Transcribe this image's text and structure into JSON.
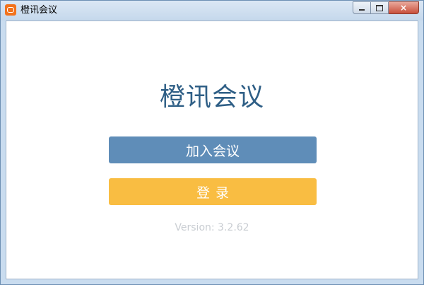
{
  "window": {
    "title": "橙讯会议",
    "controls": {
      "close_label": "×"
    }
  },
  "main": {
    "brand_title": "橙讯会议",
    "join_button_label": "加入会议",
    "login_button_label": "登录",
    "version_text": "Version: 3.2.62"
  },
  "colors": {
    "brand_text": "#2f5f86",
    "join_button": "#5f8db8",
    "login_button": "#f9bd42",
    "app_icon": "#f2721c"
  },
  "icons": {
    "app": "app-logo-icon",
    "minimize": "minimize-icon",
    "maximize": "maximize-icon",
    "close": "close-icon"
  }
}
